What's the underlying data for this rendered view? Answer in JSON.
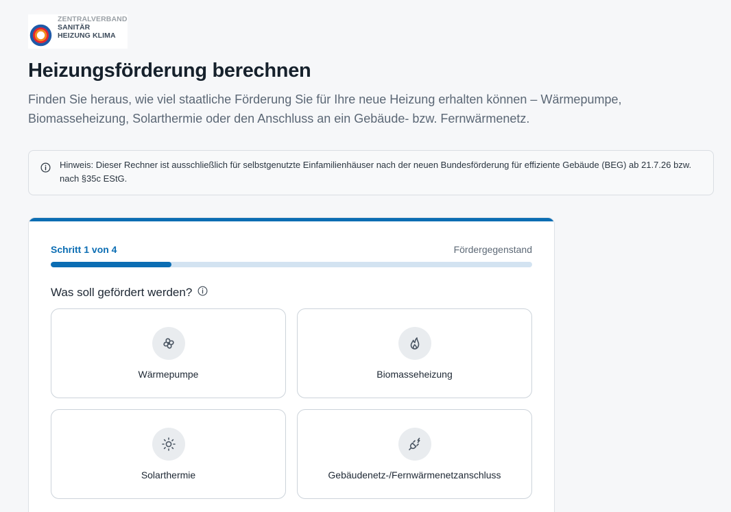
{
  "logo": {
    "line1": "ZENTRALVERBAND",
    "line2": "SANITÄR",
    "line3": "HEIZUNG KLIMA"
  },
  "header": {
    "title": "Heizungsförderung berechnen",
    "subtitle": "Finden Sie heraus, wie viel staatliche Förderung Sie für Ihre neue Heizung erhalten können – Wärmepumpe, Biomasseheizung, Solarthermie oder den Anschluss an ein Gebäude- bzw. Fernwärmenetz."
  },
  "notice": {
    "icon": "info-icon",
    "text": "Hinweis: Dieser Rechner ist ausschließlich für selbstgenutzte Einfamilienhäuser nach der neuen Bundesförderung für effiziente Gebäude (BEG) ab 21.7.26 bzw. nach §35c EStG."
  },
  "wizard": {
    "step_label": "Schritt 1 von 4",
    "step_name": "Fördergegenstand",
    "progress_fraction": 0.25,
    "question": "Was soll gefördert werden?",
    "options": [
      {
        "label": "Wärmepumpe",
        "icon": "fan-icon"
      },
      {
        "label": "Biomasseheizung",
        "icon": "flame-icon"
      },
      {
        "label": "Solarthermie",
        "icon": "sun-icon"
      },
      {
        "label": "Gebäudenetz-/Fernwärmenetzanschluss",
        "icon": "plug-icon"
      }
    ]
  },
  "colors": {
    "accent": "#0b6db3",
    "progress_track": "#d3e3f1",
    "icon_bg": "#e9ecef",
    "logo_orange": "#f28c1d",
    "logo_blue": "#1f5aa8"
  }
}
